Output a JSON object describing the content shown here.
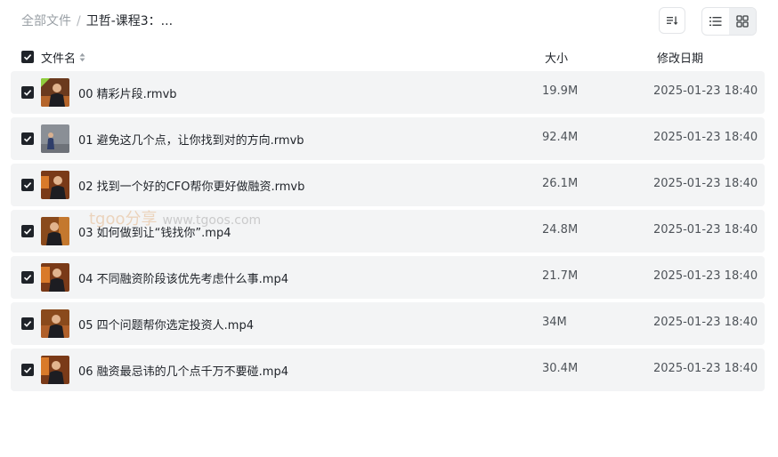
{
  "breadcrumb": {
    "root": "全部文件",
    "separator": "/",
    "current": "卫哲-课程3：..."
  },
  "toolbar": {
    "sort_icon": "sort-icon",
    "list_view_icon": "list-view-icon",
    "grid_view_icon": "grid-view-icon"
  },
  "columns": {
    "name": "文件名",
    "size": "大小",
    "date": "修改日期"
  },
  "files": [
    {
      "name": "00 精彩片段.rmvb",
      "size": "19.9M",
      "date": "2025-01-23 18:40"
    },
    {
      "name": "01 避免这几个点，让你找到对的方向.rmvb",
      "size": "92.4M",
      "date": "2025-01-23 18:40"
    },
    {
      "name": "02 找到一个好的CFO帮你更好做融资.rmvb",
      "size": "26.1M",
      "date": "2025-01-23 18:40"
    },
    {
      "name": "03 如何做到让“钱找你”.mp4",
      "size": "24.8M",
      "date": "2025-01-23 18:40"
    },
    {
      "name": "04 不同融资阶段该优先考虑什么事.mp4",
      "size": "21.7M",
      "date": "2025-01-23 18:40"
    },
    {
      "name": "05 四个问题帮你选定投资人.mp4",
      "size": "34M",
      "date": "2025-01-23 18:40"
    },
    {
      "name": "06 融资最忌讳的几个点千万不要碰.mp4",
      "size": "30.4M",
      "date": "2025-01-23 18:40"
    }
  ],
  "watermark": {
    "brand": "tgoo分享",
    "url": "www.tgoos.com"
  },
  "colors": {
    "row_bg": "#f3f4f5",
    "checkbox": "#1f2329",
    "text_muted": "#9aa0a6"
  }
}
